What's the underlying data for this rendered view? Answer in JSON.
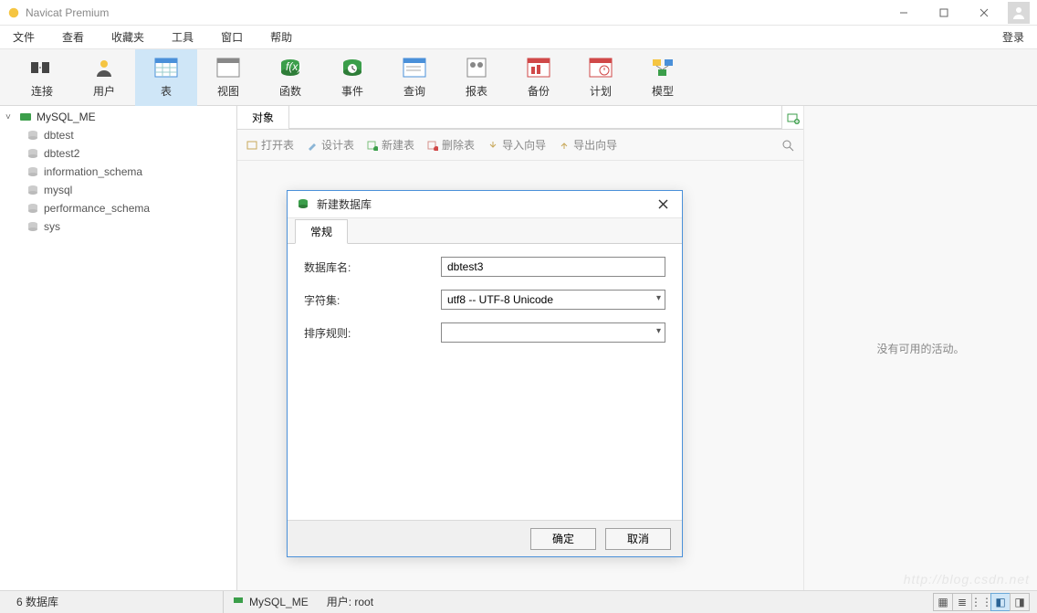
{
  "app": {
    "title": "Navicat Premium"
  },
  "menu": {
    "file": "文件",
    "view": "查看",
    "fav": "收藏夹",
    "tools": "工具",
    "window": "窗口",
    "help": "帮助",
    "login": "登录"
  },
  "toolbar": {
    "connect": "连接",
    "user": "用户",
    "table": "表",
    "viewbtn": "视图",
    "function": "函数",
    "event": "事件",
    "query": "查询",
    "report": "报表",
    "backup": "备份",
    "schedule": "计划",
    "model": "模型"
  },
  "tree": {
    "root": "MySQL_ME",
    "children": [
      "dbtest",
      "dbtest2",
      "information_schema",
      "mysql",
      "performance_schema",
      "sys"
    ]
  },
  "objbar": {
    "objects": "对象",
    "open": "打开表",
    "design": "设计表",
    "newtbl": "新建表",
    "deltbl": "删除表",
    "impwiz": "导入向导",
    "expwiz": "导出向导"
  },
  "rightpanel": {
    "empty": "没有可用的活动。"
  },
  "status": {
    "count": "6  数据库",
    "conn": "MySQL_ME",
    "user": "用户: root"
  },
  "modal": {
    "title": "新建数据库",
    "tab": "常规",
    "labels": {
      "name": "数据库名:",
      "charset": "字符集:",
      "collation": "排序规则:"
    },
    "values": {
      "name": "dbtest3",
      "charset": "utf8 -- UTF-8 Unicode",
      "collation": ""
    },
    "ok": "确定",
    "cancel": "取消"
  },
  "watermark": "http://blog.csdn.net"
}
